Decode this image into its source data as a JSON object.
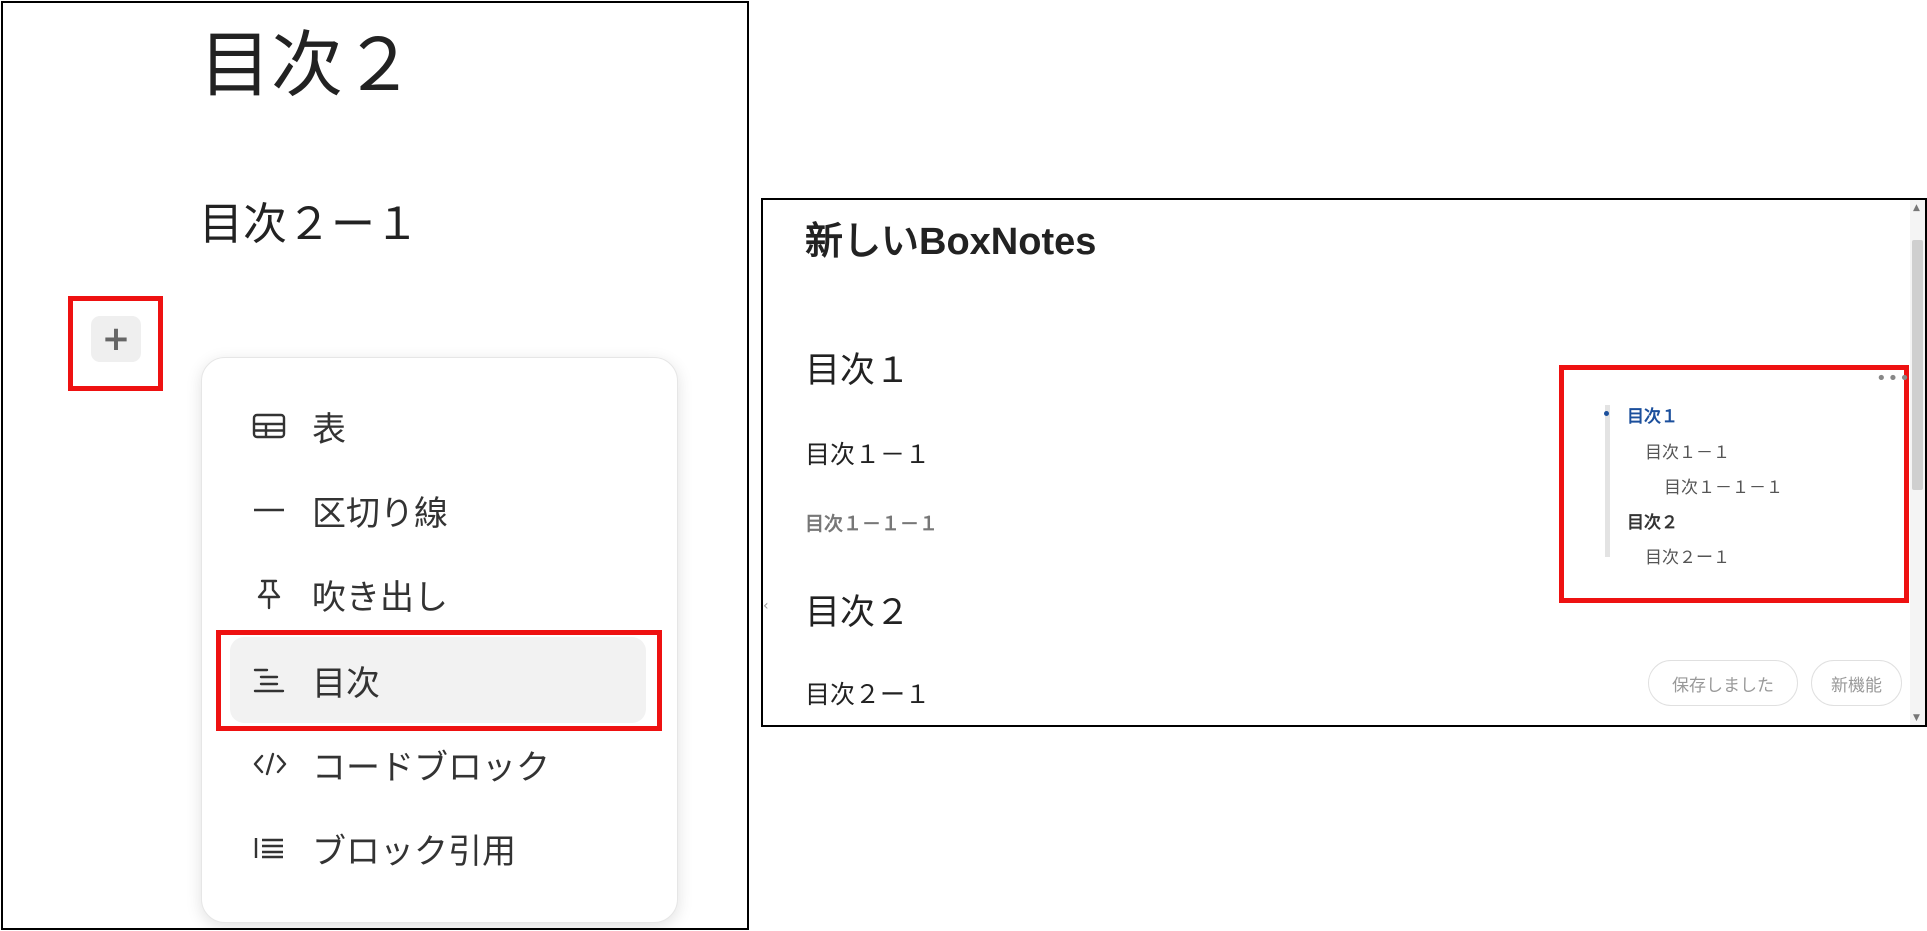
{
  "left_panel": {
    "heading_1": "目次２",
    "heading_2": "目次２ー１",
    "add_block_symbol": "+",
    "menu": {
      "items": [
        {
          "label": "表",
          "icon": "table-icon"
        },
        {
          "label": "区切り線",
          "icon": "divider-icon"
        },
        {
          "label": "吹き出し",
          "icon": "pin-icon"
        },
        {
          "label": "目次",
          "icon": "toc-icon",
          "selected": true
        },
        {
          "label": "コードブロック",
          "icon": "code-icon"
        },
        {
          "label": "ブロック引用",
          "icon": "blockquote-icon"
        }
      ]
    }
  },
  "right_panel": {
    "doc_title": "新しいBoxNotes",
    "content": {
      "h1_a": "目次１",
      "h2_a": "目次１－１",
      "h3_a": "目次１－１－１",
      "h1_b": "目次２",
      "h2_b": "目次２ー１"
    },
    "outline": {
      "more_symbol": "•••",
      "items": [
        {
          "label": "目次１",
          "level": 1,
          "current": true
        },
        {
          "label": "目次１－１",
          "level": 2
        },
        {
          "label": "目次１－１－１",
          "level": 3
        },
        {
          "label": "目次２",
          "level": 1
        },
        {
          "label": "目次２ー１",
          "level": 2
        }
      ]
    },
    "status": {
      "saved_label": "保存しました",
      "whats_new_label": "新機能"
    }
  },
  "colors": {
    "highlight": "#ee1111",
    "outline_accent": "#1b4f9c",
    "text": "#222222"
  }
}
